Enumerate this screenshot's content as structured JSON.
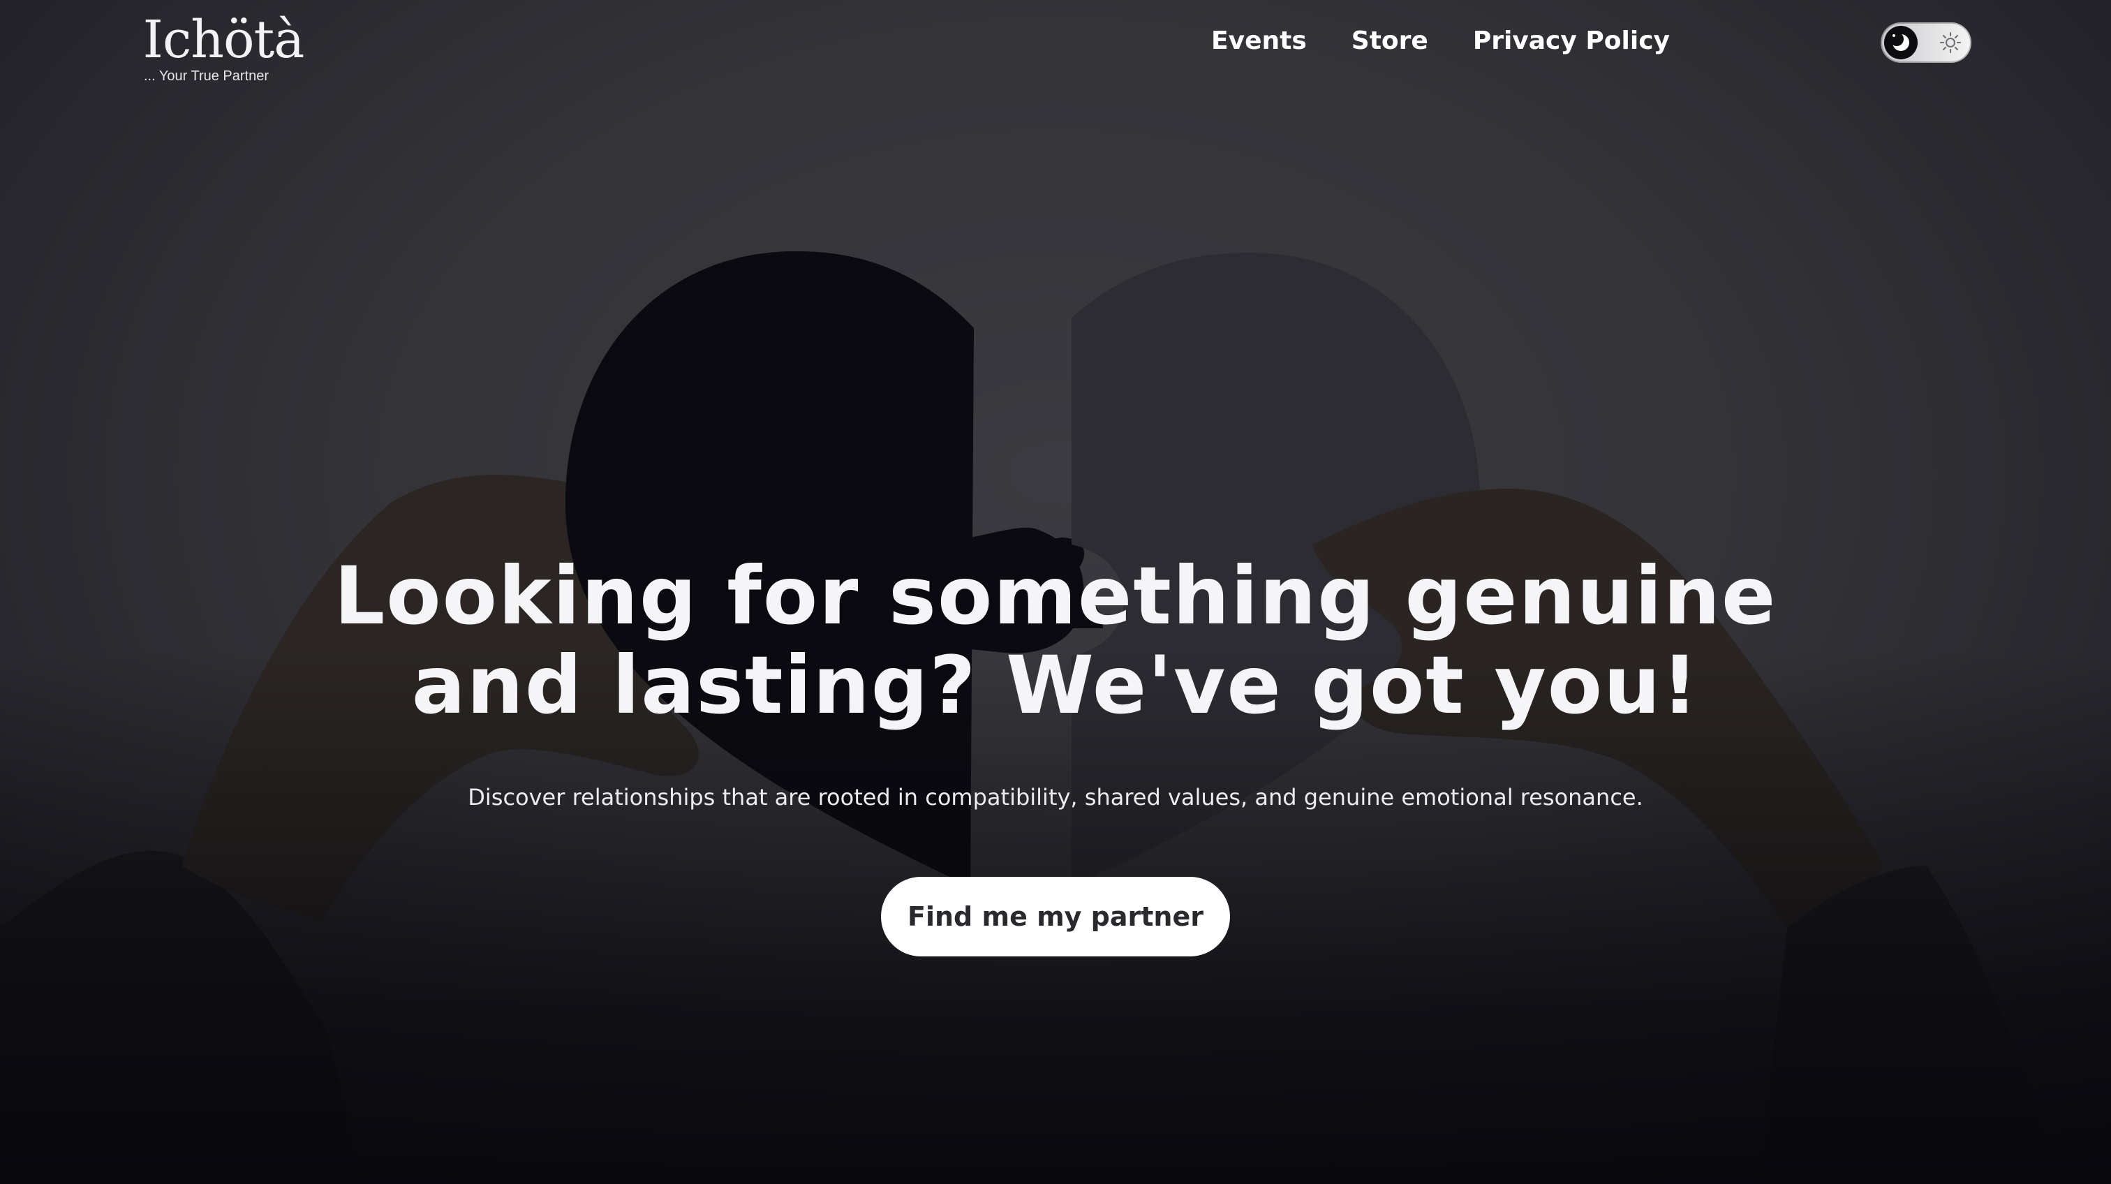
{
  "brand": {
    "name": "Ichötà",
    "tagline": "... Your True Partner"
  },
  "nav": {
    "items": [
      {
        "label": "Events"
      },
      {
        "label": "Store"
      },
      {
        "label": "Privacy Policy"
      }
    ]
  },
  "theme_toggle": {
    "state": "dark",
    "left_icon": "moon-icon",
    "right_icon": "sun-icon"
  },
  "hero": {
    "headline": "Looking for something genuine and lasting? We've got you!",
    "subtext": "Discover relationships that are rooted in compatibility, shared values, and genuine emotional resonance.",
    "cta_label": "Find me my partner",
    "background_image": "hands-holding-heart-puzzle-pieces"
  },
  "colors": {
    "background": "#333338",
    "text": "#ffffff",
    "cta_background": "#ffffff",
    "cta_text": "#2a2a2e"
  }
}
